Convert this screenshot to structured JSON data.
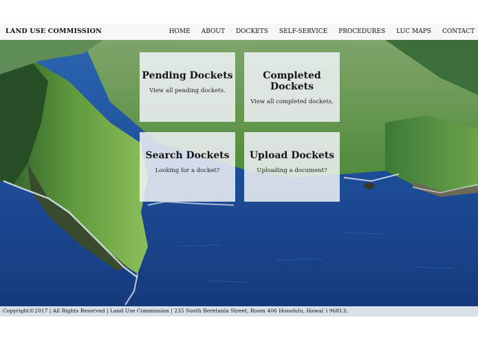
{
  "header": {
    "brand": "LAND USE COMMISSION",
    "nav": [
      "HOME",
      "ABOUT",
      "DOCKETS",
      "SELF-SERVICE",
      "PROCEDURES",
      "LUC MAPS",
      "CONTACT"
    ]
  },
  "cards": [
    {
      "title": "Pending Dockets",
      "desc": "View all pending dockets."
    },
    {
      "title": "Completed Dockets",
      "desc": "View all completed dockets."
    },
    {
      "title": "Search Dockets",
      "desc": "Looking for a docket?"
    },
    {
      "title": "Upload Dockets",
      "desc": "Uploading a document?"
    }
  ],
  "footer": {
    "text": "Copyright©2017 | All Rights Reserved | Land Use Commission | 235 South Beretania Street, Room 406 Honolulu, Hawai`i 96813;"
  },
  "colors": {
    "ocean": "#1f4e9a",
    "cliff_green": "#5d9a3a",
    "card_bg": "#f0f2f6",
    "footer_bg": "#d9e0e7"
  }
}
